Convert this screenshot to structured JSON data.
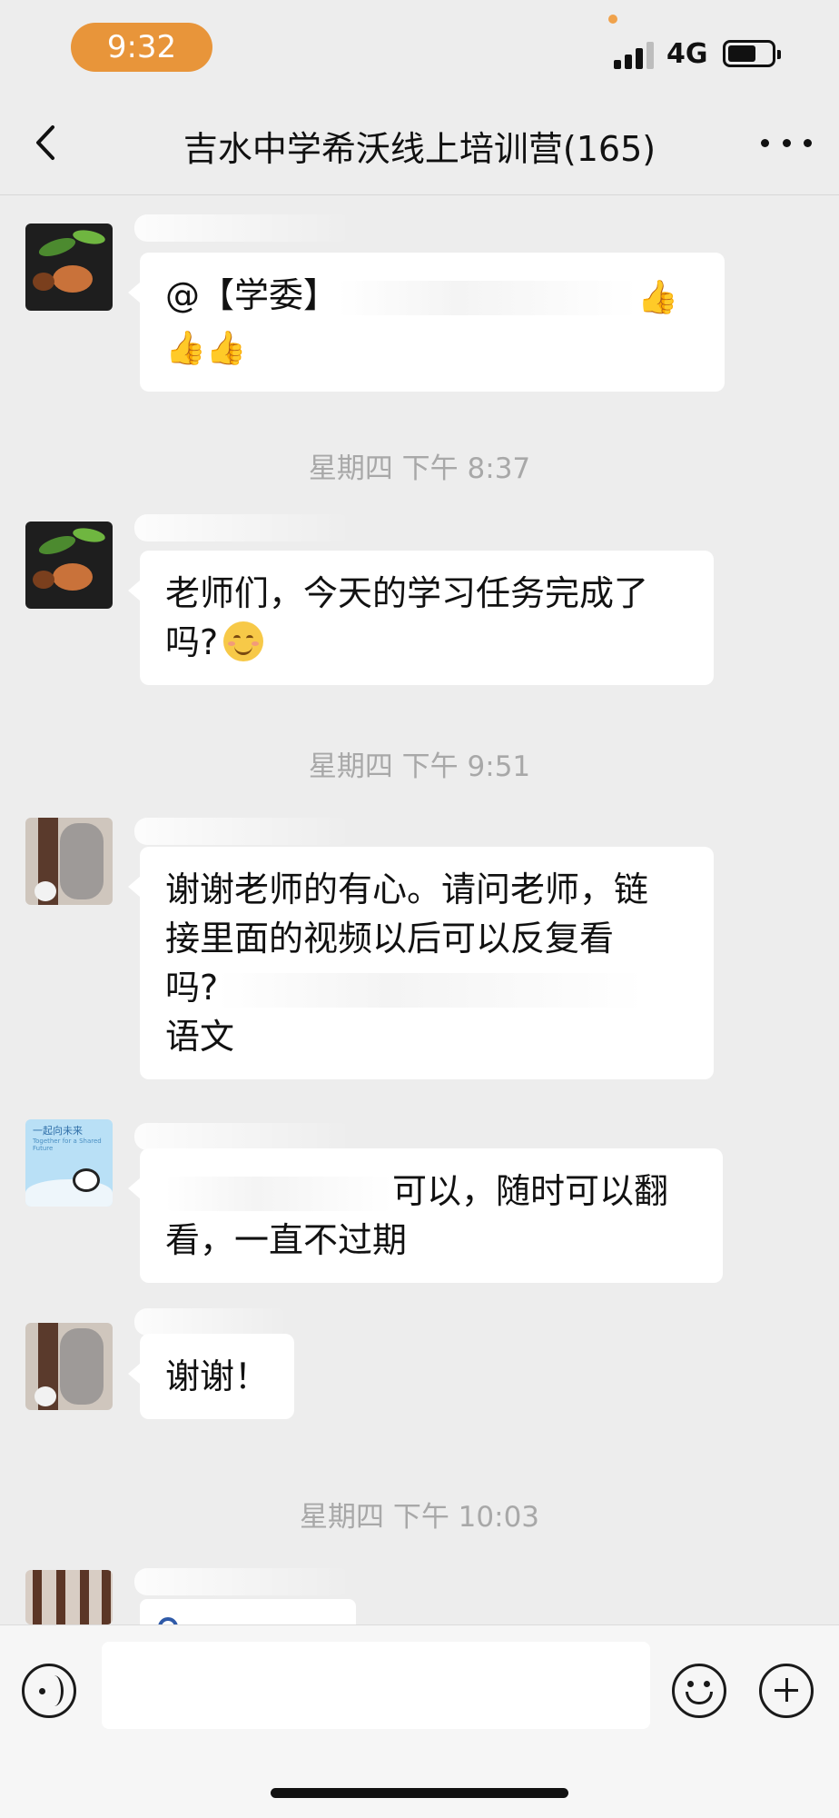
{
  "status_bar": {
    "time": "9:32",
    "network": "4G"
  },
  "nav": {
    "title": "吉水中学希沃线上培训营(165)"
  },
  "messages": [
    {
      "id": "m1",
      "line1": "@【学委】",
      "line1_tail": "👍",
      "line2": "👍👍"
    },
    {
      "id": "t1",
      "timestamp": "星期四 下午 8:37"
    },
    {
      "id": "m2",
      "line1": "老师们，今天的学习任务完成了",
      "line2": "吗?"
    },
    {
      "id": "t2",
      "timestamp": "星期四 下午 9:51"
    },
    {
      "id": "m3",
      "line1": "谢谢老师的有心。请问老师，链",
      "line2": "接里面的视频以后可以反复看",
      "line3": "吗?",
      "line4": "语文"
    },
    {
      "id": "m4",
      "line1": "可以，随时可以翻",
      "line2": "看，一直不过期"
    },
    {
      "id": "m5",
      "line1": "谢谢！"
    },
    {
      "id": "t3",
      "timestamp": "星期四 下午 10:03"
    }
  ],
  "avatars": {
    "panda_title": "一起向未来",
    "panda_sub": "Together for a Shared Future"
  },
  "icons": {
    "back": "chevron-left-icon",
    "more": "more-icon",
    "voice": "voice-icon",
    "emoji": "emoji-icon",
    "plus": "plus-icon"
  }
}
